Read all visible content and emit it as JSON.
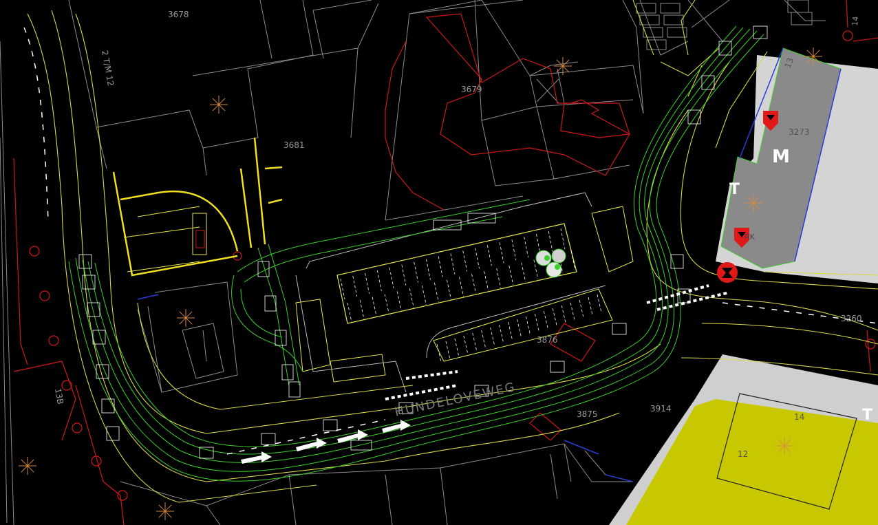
{
  "drawing": {
    "parcel_labels": [
      "3678",
      "3679",
      "3681",
      "3273",
      "3876",
      "3875",
      "3914",
      "3260"
    ],
    "street_labels": [
      "2 T/M 12",
      "13B",
      "14",
      "12",
      "13",
      "14"
    ],
    "symbols": {
      "metro": "M",
      "tram_a": "T",
      "tram_b": "T",
      "tram_c": "T"
    },
    "partial_labels": {
      "left_text": "RK",
      "road_name": "HUNDELOVEWEG"
    }
  },
  "colors": {
    "background": "#000000",
    "building_outline": "#8c8c8c",
    "road_yellow": "#e8e84a",
    "road_green": "#3ccf2c",
    "accent_red": "#e01818",
    "blue_line": "#2a3cd8",
    "grey_fill": "#8a8a8a",
    "light_grey_fill": "#d4d4d4",
    "olive_fill": "#c8c800"
  },
  "icons": [
    "star-icon",
    "tree-icon",
    "shield-icon",
    "stop-sign-icon",
    "arrow-icon"
  ]
}
